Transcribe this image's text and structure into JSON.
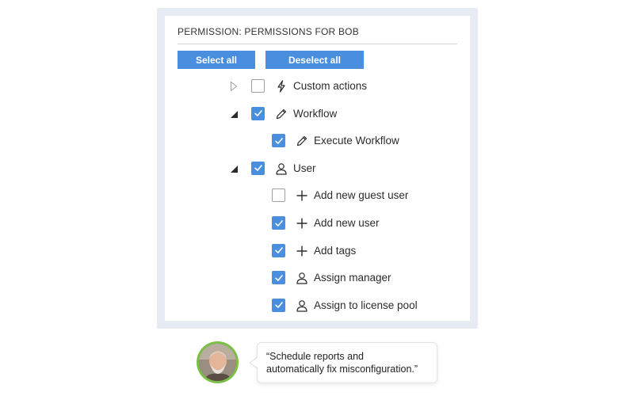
{
  "panel": {
    "title": "PERMISSION: PERMISSIONS FOR BOB",
    "select_all_label": "Select all",
    "deselect_all_label": "Deselect all"
  },
  "tree": [
    {
      "label": "Custom actions",
      "checked": false,
      "expander": "collapsed",
      "icon": "lightning-icon",
      "level": 0
    },
    {
      "label": "Workflow",
      "checked": true,
      "expander": "expanded",
      "icon": "pencil-icon",
      "level": 0
    },
    {
      "label": "Execute Workflow",
      "checked": true,
      "expander": "none",
      "icon": "pencil-icon",
      "level": 1
    },
    {
      "label": "User",
      "checked": true,
      "expander": "expanded",
      "icon": "user-icon",
      "level": 0
    },
    {
      "label": "Add new guest user",
      "checked": false,
      "expander": "none",
      "icon": "plus-icon",
      "level": 1
    },
    {
      "label": "Add new user",
      "checked": true,
      "expander": "none",
      "icon": "plus-icon",
      "level": 1
    },
    {
      "label": "Add tags",
      "checked": true,
      "expander": "none",
      "icon": "plus-icon",
      "level": 1
    },
    {
      "label": "Assign manager",
      "checked": true,
      "expander": "none",
      "icon": "user-icon",
      "level": 1
    },
    {
      "label": "Assign to license pool",
      "checked": true,
      "expander": "none",
      "icon": "user-icon",
      "level": 1
    }
  ],
  "testimonial": {
    "line1": "“Schedule reports and",
    "line2": "automatically fix misconfiguration.”"
  },
  "colors": {
    "accent": "#4a8fdf",
    "avatar_ring": "#7ac143",
    "frame": "#e7ecf4"
  }
}
